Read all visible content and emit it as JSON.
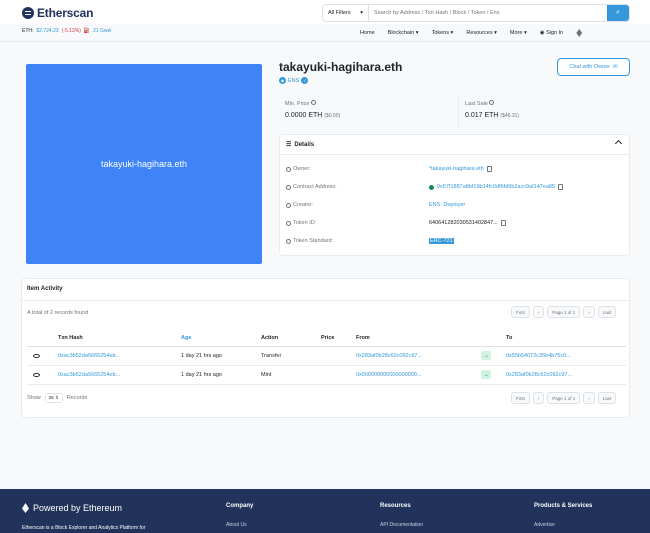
{
  "header": {
    "logo_text": "Etherscan",
    "filter_label": "All Filters",
    "search_placeholder": "Search by Address / Txn Hash / Block / Token / Ens",
    "eth_label": "ETH:",
    "eth_price": "$2,724.23",
    "eth_change": "(-5.13%)",
    "gas": "21 Gwei",
    "nav": [
      "Home",
      "Blockchain",
      "Tokens",
      "Resources",
      "More",
      "Sign In"
    ]
  },
  "nft": {
    "name": "takayuki-hagihara.eth",
    "image_text": "takayuki-hagihara.eth",
    "collection": "ENS",
    "chat_label": "Chat with Owner",
    "min_price_label": "Min. Price",
    "min_price": "0.0000 ETH",
    "min_price_usd": "($0.00)",
    "last_sale_label": "Last Sale",
    "last_sale": "0.017 ETH",
    "last_sale_usd": "($46.31)"
  },
  "details": {
    "title": "Details",
    "rows": [
      {
        "label": "Owner:",
        "value": "*takayuki-hagihara.eth"
      },
      {
        "label": "Contract Address:",
        "value": "0x57f1887a8bf19b14fc0df6fd9b2acc9af147ea85"
      },
      {
        "label": "Creator:",
        "value": "ENS: Deployer"
      },
      {
        "label": "Token ID:",
        "value": "640641282030531402847..."
      },
      {
        "label": "Token Standard:",
        "value": "ERC-721"
      }
    ]
  },
  "activity": {
    "title": "Item Activity",
    "total": "A total of 2 records found",
    "pager": [
      "First",
      "‹",
      "Page 1 of 1",
      "›",
      "Last"
    ],
    "columns": [
      "Txn Hash",
      "Age",
      "Action",
      "Price",
      "From",
      "To"
    ],
    "rows": [
      {
        "hash": "0xac3b52da5665254eb...",
        "age": "1 day 21 hrs ago",
        "action": "Transfer",
        "price": "",
        "from": "0x283af0b28c62c092c97...",
        "to": "0x55b54072c35b4b75c0..."
      },
      {
        "hash": "0xac3b52da5665254eb...",
        "age": "1 day 21 hrs ago",
        "action": "Mint",
        "price": "",
        "from": "0x000000000000000000...",
        "to": "0x283af0b28c62c092c97..."
      }
    ],
    "show_label": "Show",
    "show_value": "25",
    "records_label": "Records"
  },
  "footer": {
    "powered": "Powered by Ethereum",
    "tagline": "Etherscan is a Block Explorer and Analytics Platform for",
    "cols": [
      {
        "head": "Company",
        "link": "About Us"
      },
      {
        "head": "Resources",
        "link": "API Documentation"
      },
      {
        "head": "Products & Services",
        "link": "Advertise"
      }
    ]
  },
  "colors": {
    "accent": "#3498db",
    "footer": "#21325b",
    "nft_bg": "#3f83f8"
  }
}
